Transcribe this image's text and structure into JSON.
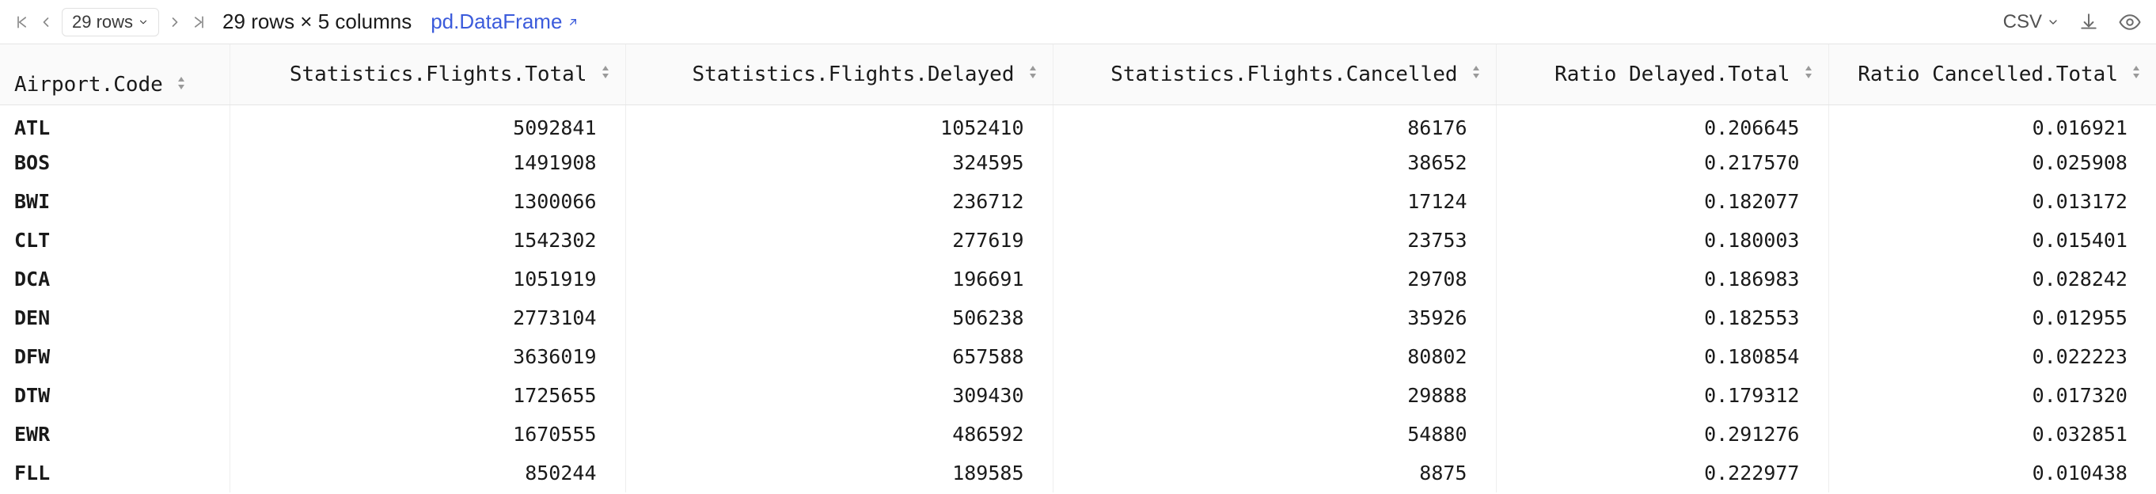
{
  "toolbar": {
    "rows_label": "29 rows",
    "summary": "29 rows × 5 columns",
    "df_type": "pd.DataFrame",
    "csv_label": "CSV"
  },
  "columns": {
    "index": "Airport.Code",
    "c0": "Statistics.Flights.Total",
    "c1": "Statistics.Flights.Delayed",
    "c2": "Statistics.Flights.Cancelled",
    "c3": "Ratio Delayed.Total",
    "c4": "Ratio Cancelled.Total"
  },
  "rows": [
    {
      "code": "ATL",
      "total": "5092841",
      "delayed": "1052410",
      "cancelled": "86176",
      "rdt": "0.206645",
      "rct": "0.016921"
    },
    {
      "code": "BOS",
      "total": "1491908",
      "delayed": "324595",
      "cancelled": "38652",
      "rdt": "0.217570",
      "rct": "0.025908"
    },
    {
      "code": "BWI",
      "total": "1300066",
      "delayed": "236712",
      "cancelled": "17124",
      "rdt": "0.182077",
      "rct": "0.013172"
    },
    {
      "code": "CLT",
      "total": "1542302",
      "delayed": "277619",
      "cancelled": "23753",
      "rdt": "0.180003",
      "rct": "0.015401"
    },
    {
      "code": "DCA",
      "total": "1051919",
      "delayed": "196691",
      "cancelled": "29708",
      "rdt": "0.186983",
      "rct": "0.028242"
    },
    {
      "code": "DEN",
      "total": "2773104",
      "delayed": "506238",
      "cancelled": "35926",
      "rdt": "0.182553",
      "rct": "0.012955"
    },
    {
      "code": "DFW",
      "total": "3636019",
      "delayed": "657588",
      "cancelled": "80802",
      "rdt": "0.180854",
      "rct": "0.022223"
    },
    {
      "code": "DTW",
      "total": "1725655",
      "delayed": "309430",
      "cancelled": "29888",
      "rdt": "0.179312",
      "rct": "0.017320"
    },
    {
      "code": "EWR",
      "total": "1670555",
      "delayed": "486592",
      "cancelled": "54880",
      "rdt": "0.291276",
      "rct": "0.032851"
    },
    {
      "code": "FLL",
      "total": "850244",
      "delayed": "189585",
      "cancelled": "8875",
      "rdt": "0.222977",
      "rct": "0.010438"
    }
  ]
}
